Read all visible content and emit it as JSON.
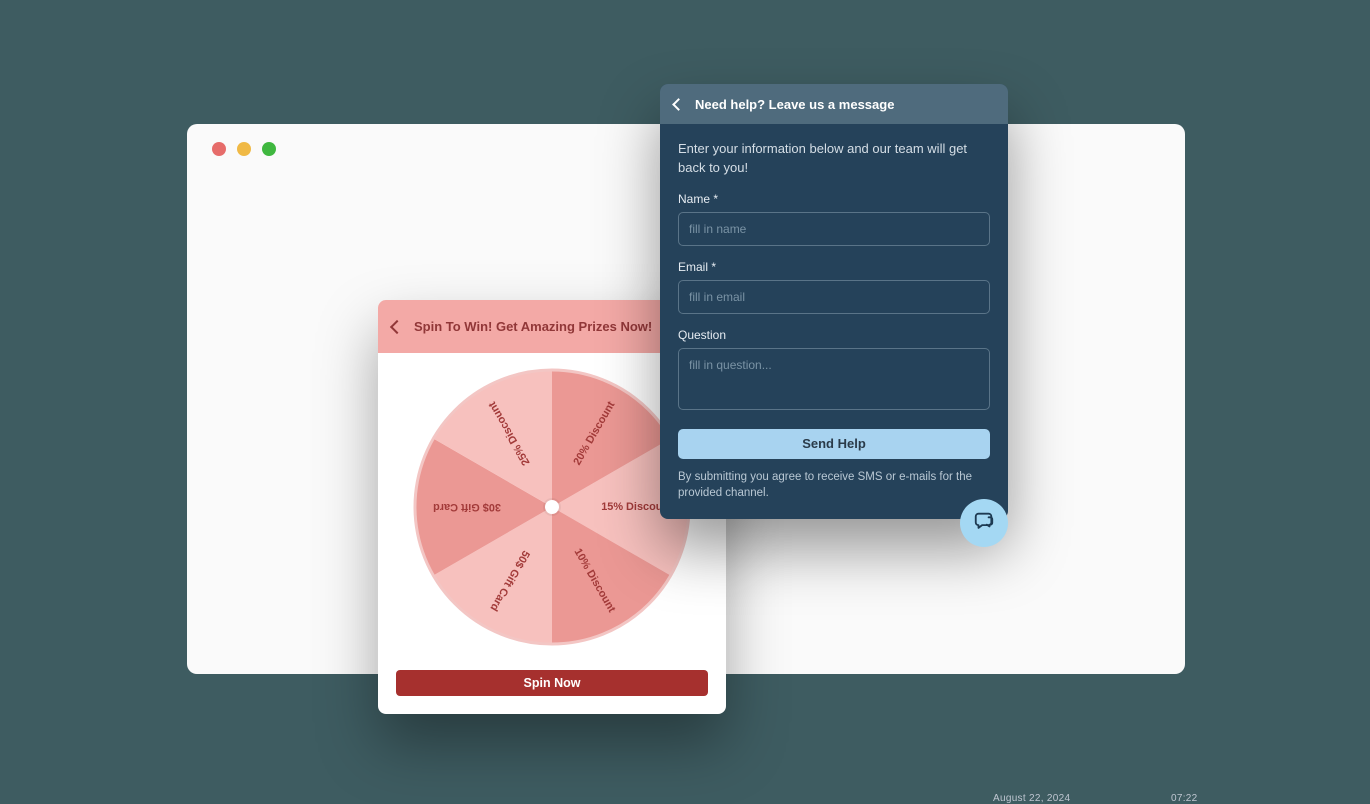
{
  "spin": {
    "title": "Spin To Win! Get Amazing Prizes Now!",
    "button": "Spin Now",
    "segments": [
      {
        "label": "15% Discount",
        "color": "#f7c1be"
      },
      {
        "label": "10% Discount",
        "color": "#eb9894"
      },
      {
        "label": "50$ Gift Card",
        "color": "#f7c1be"
      },
      {
        "label": "30$ Gift Card",
        "color": "#eb9894"
      },
      {
        "label": "25% Discount",
        "color": "#f7c1be"
      },
      {
        "label": "20% Discount",
        "color": "#eb9894"
      }
    ]
  },
  "help": {
    "title": "Need help? Leave us a message",
    "intro": "Enter your information below and our team will get back to you!",
    "name_label": "Name *",
    "name_placeholder": "fill in name",
    "email_label": "Email *",
    "email_placeholder": "fill in email",
    "question_label": "Question",
    "question_placeholder": "fill in question...",
    "send_label": "Send Help",
    "disclaimer": "By submitting you agree to receive SMS or e-mails for the provided channel."
  },
  "background": {
    "text_a": "August 22, 2024",
    "text_b": "07:22"
  }
}
